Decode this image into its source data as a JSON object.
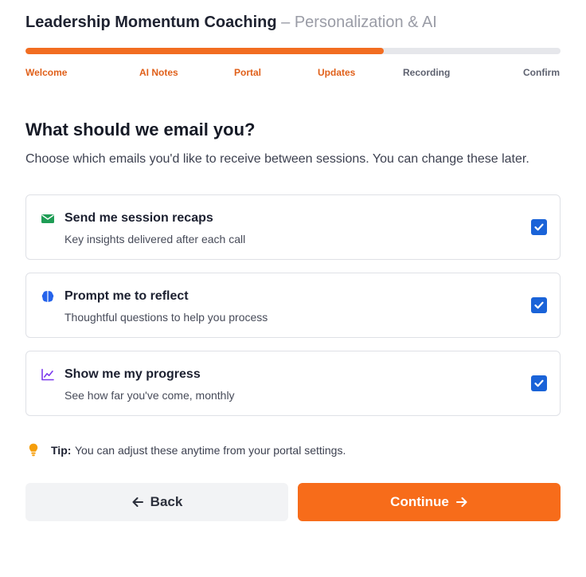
{
  "header": {
    "brand": "Leadership Momentum Coaching",
    "separator": "–",
    "subtitle": "Personalization & AI"
  },
  "progress": {
    "fraction": 0.67
  },
  "steps": [
    {
      "label": "Welcome",
      "status": "done"
    },
    {
      "label": "AI Notes",
      "status": "done"
    },
    {
      "label": "Portal",
      "status": "done"
    },
    {
      "label": "Updates",
      "status": "done"
    },
    {
      "label": "Recording",
      "status": "todo"
    },
    {
      "label": "Confirm",
      "status": "todo"
    }
  ],
  "page": {
    "title": "What should we email you?",
    "lead": "Choose which emails you'd like to receive between sessions. You can change these later."
  },
  "options": [
    {
      "icon": "envelope-icon",
      "title": "Send me session recaps",
      "description": "Key insights delivered after each call",
      "checked": true
    },
    {
      "icon": "brain-icon",
      "title": "Prompt me to reflect",
      "description": "Thoughtful questions to help you process",
      "checked": true
    },
    {
      "icon": "chart-line-icon",
      "title": "Show me my progress",
      "description": "See how far you've come, monthly",
      "checked": true
    }
  ],
  "tip": {
    "icon": "lightbulb-icon",
    "label": "Tip:",
    "text": "You can adjust these anytime from your portal settings."
  },
  "actions": {
    "back_label": "Back",
    "continue_label": "Continue"
  },
  "colors": {
    "accent": "#f76c1a",
    "step_done": "#e0601a",
    "checkbox": "#1a63d8",
    "envelope_icon": "#1f9d55",
    "brain_icon": "#2563eb",
    "chart_icon": "#7c3aed",
    "tip_icon": "#f59e0b"
  }
}
